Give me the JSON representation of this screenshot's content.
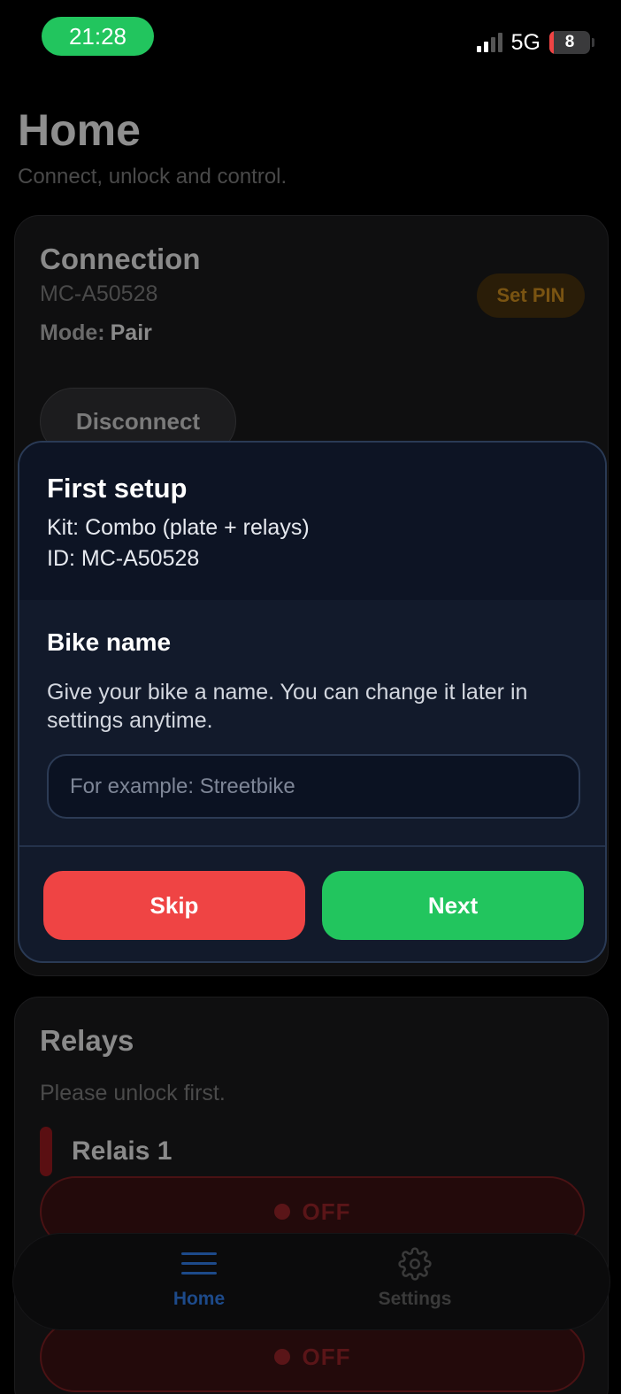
{
  "status_bar": {
    "time": "21:28",
    "network": "5G",
    "battery": "8",
    "time_pill_color": "#22c55e"
  },
  "header": {
    "title": "Home",
    "subtitle": "Connect, unlock and control."
  },
  "connection_card": {
    "title": "Connection",
    "device_id": "MC-A50528",
    "mode_label": "Mode:",
    "mode_value": "Pair",
    "set_pin_label": "Set PIN",
    "disconnect_label": "Disconnect"
  },
  "relays_card": {
    "title": "Relays",
    "hint": "Please unlock first.",
    "relay_name": "Relais 1",
    "relay_state_1": "OFF",
    "relay_state_2": "OFF"
  },
  "bottom_nav": {
    "home_label": "Home",
    "settings_label": "Settings",
    "icons": [
      "menu-icon",
      "gear-icon"
    ]
  },
  "modal": {
    "title": "First setup",
    "kit": "Kit: Combo (plate + relays)",
    "id": "ID: MC-A50528",
    "section_title": "Bike name",
    "section_desc": "Give your bike a name. You can change it later in settings anytime.",
    "input_value": "",
    "input_placeholder": "For example: Streetbike",
    "skip_label": "Skip",
    "next_label": "Next",
    "skip_color": "#ef4444",
    "next_color": "#22c55e"
  }
}
